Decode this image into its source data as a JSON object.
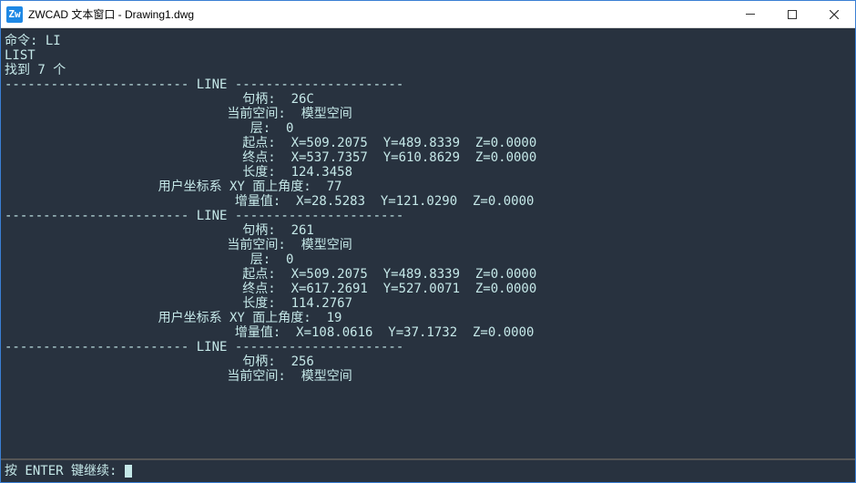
{
  "title": "ZWCAD 文本窗口 - Drawing1.dwg",
  "app_icon_text": "Zw",
  "cmd_line": "命令: LI",
  "list_cmd": "LIST",
  "found_text": "找到 7 个",
  "header_line": "LINE",
  "fields": {
    "handle": "句柄:",
    "space": "当前空间:",
    "layer": "层:",
    "start": "起点:",
    "end": "终点:",
    "length": "长度:",
    "angle": "用户坐标系 XY 面上角度:",
    "delta": "增量值:",
    "modelspace": "模型空间",
    "layer0": "0"
  },
  "entities": [
    {
      "handle": "26C",
      "start": "X=509.2075  Y=489.8339  Z=0.0000",
      "end": "X=537.7357  Y=610.8629  Z=0.0000",
      "length": "124.3458",
      "angle": "77",
      "delta": "X=28.5283  Y=121.0290  Z=0.0000"
    },
    {
      "handle": "261",
      "start": "X=509.2075  Y=489.8339  Z=0.0000",
      "end": "X=617.2691  Y=527.0071  Z=0.0000",
      "length": "114.2767",
      "angle": "19",
      "delta": "X=108.0616  Y=37.1732  Z=0.0000"
    },
    {
      "handle": "256",
      "start": "",
      "end": "",
      "length": "",
      "angle": "",
      "delta": ""
    }
  ],
  "prompt": "按 ENTER 键继续: "
}
